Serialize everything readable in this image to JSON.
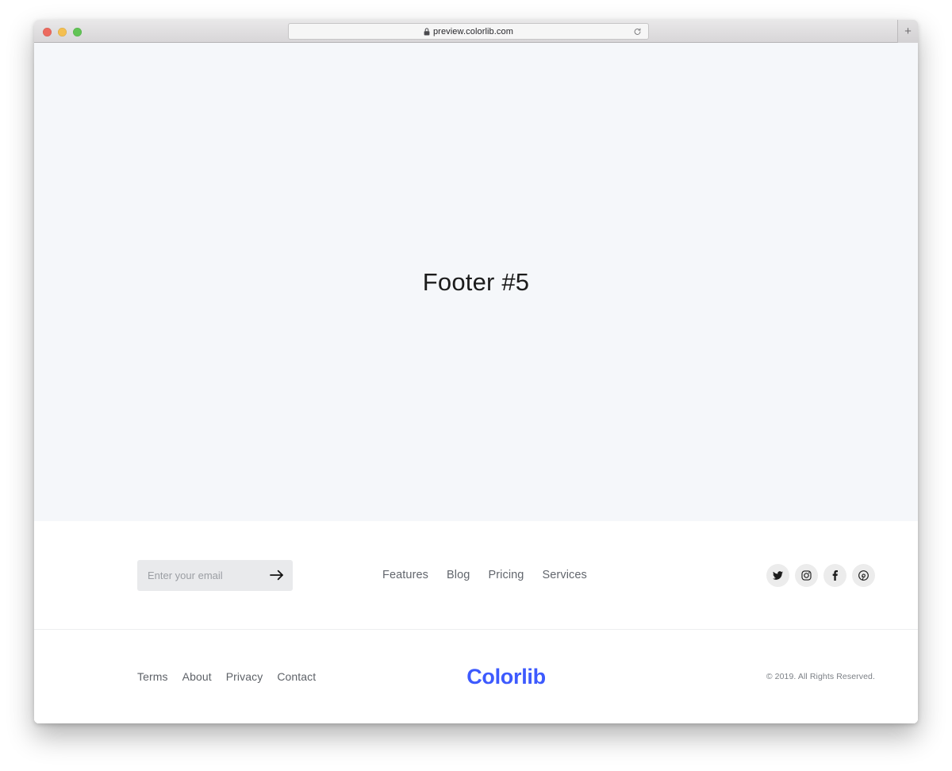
{
  "browser": {
    "traffic_lights": [
      {
        "name": "close",
        "color": "#ec6a5f"
      },
      {
        "name": "minimize",
        "color": "#f4bf50"
      },
      {
        "name": "maximize",
        "color": "#61c455"
      }
    ],
    "url": "preview.colorlib.com",
    "lock_icon": "lock-icon",
    "reload_icon": "reload-icon",
    "new_tab_label": "+"
  },
  "hero": {
    "title": "Footer #5",
    "background": "#f5f7fa"
  },
  "footer": {
    "subscribe": {
      "placeholder": "Enter your email",
      "value": "",
      "submit_icon": "arrow-right-icon"
    },
    "nav_links": [
      {
        "label": "Features"
      },
      {
        "label": "Blog"
      },
      {
        "label": "Pricing"
      },
      {
        "label": "Services"
      }
    ],
    "social_links": [
      {
        "name": "twitter",
        "icon": "twitter-icon"
      },
      {
        "name": "instagram",
        "icon": "instagram-icon"
      },
      {
        "name": "facebook",
        "icon": "facebook-icon"
      },
      {
        "name": "pinterest",
        "icon": "pinterest-icon"
      }
    ],
    "legal_links": [
      {
        "label": "Terms"
      },
      {
        "label": "About"
      },
      {
        "label": "Privacy"
      },
      {
        "label": "Contact"
      }
    ],
    "logo": "Colorlib",
    "logo_color": "#3d5afe",
    "copyright": "© 2019. All Rights Reserved."
  }
}
